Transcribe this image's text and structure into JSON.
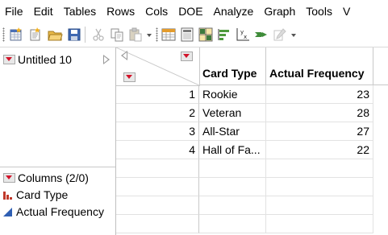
{
  "menu": [
    "File",
    "Edit",
    "Tables",
    "Rows",
    "Cols",
    "DOE",
    "Analyze",
    "Graph",
    "Tools",
    "V"
  ],
  "toolbar": {
    "icons": [
      "new-data-table-icon",
      "new-script-icon",
      "open-folder-icon",
      "save-icon",
      "cut-icon",
      "copy-icon",
      "paste-icon",
      "data-table-icon",
      "distribution-icon",
      "grid-icon",
      "bar-chart-icon",
      "fit-y-by-x-icon",
      "arrow-icon",
      "edit-icon"
    ]
  },
  "table_panel": {
    "title": "Untitled 10"
  },
  "columns_panel": {
    "title": "Columns (2/0)",
    "columns": [
      {
        "name": "Card Type",
        "icon": "nominal-icon",
        "color": "#c0392b"
      },
      {
        "name": "Actual Frequency",
        "icon": "continuous-icon",
        "color": "#2f5fb3"
      }
    ]
  },
  "grid": {
    "headers": [
      "Card Type",
      "Actual Frequency"
    ],
    "rows": [
      {
        "num": "1",
        "card_type": "Rookie",
        "freq": "23"
      },
      {
        "num": "2",
        "card_type": "Veteran",
        "freq": "28"
      },
      {
        "num": "3",
        "card_type": "All-Star",
        "freq": "27"
      },
      {
        "num": "4",
        "card_type": "Hall of Fa...",
        "freq": "22"
      }
    ]
  },
  "colors": {
    "red_triangle": "#d2142a",
    "grid_line": "#e2e2e2"
  }
}
